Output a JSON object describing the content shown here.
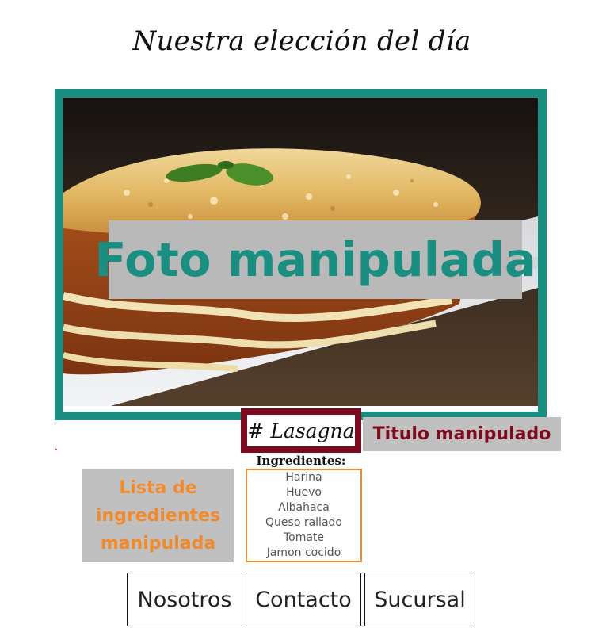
{
  "header": {
    "title": "Nuestra elección del día"
  },
  "photo": {
    "alt": "Lasagna",
    "overlay_text": "Foto manipulada",
    "frame_color": "#1b8e82"
  },
  "dish": {
    "title_tag": "# Lasagna",
    "title_overlay": "Titulo manipulado",
    "tag_border_color": "#7d0a1e"
  },
  "ingredients": {
    "heading": "Ingredientes:",
    "items": [
      "Harina",
      "Huevo",
      "Albahaca",
      "Queso rallado",
      "Tomate",
      "Jamon cocido"
    ],
    "overlay_lines": [
      "Lista de",
      "ingredientes",
      "manipulada"
    ],
    "accent_color": "#f28a2c"
  },
  "nav": {
    "items": [
      {
        "label": "Nosotros"
      },
      {
        "label": "Contacto"
      },
      {
        "label": "Sucursal"
      }
    ]
  }
}
